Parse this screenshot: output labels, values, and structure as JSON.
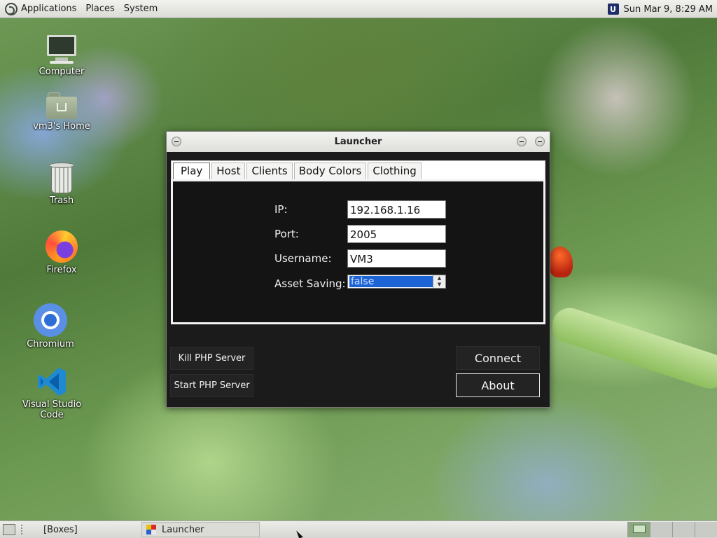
{
  "top_panel": {
    "menus": [
      "Applications",
      "Places",
      "System"
    ],
    "clock": "Sun Mar 9,  8:29 AM",
    "indicator_glyph": "U"
  },
  "desktop": {
    "icons": [
      {
        "label": "Computer",
        "icon": "computer-icon"
      },
      {
        "label": "vm3's Home",
        "icon": "home-folder-icon"
      },
      {
        "label": "Trash",
        "icon": "trash-icon"
      },
      {
        "label": "Firefox",
        "icon": "firefox-icon"
      },
      {
        "label": "Chromium",
        "icon": "chromium-icon"
      },
      {
        "label": "Visual Studio Code",
        "icon": "vscode-icon"
      }
    ]
  },
  "window": {
    "title": "Launcher",
    "tabs": [
      "Play",
      "Host",
      "Clients",
      "Body Colors",
      "Clothing"
    ],
    "active_tab": "Play",
    "form": {
      "ip_label": "IP:",
      "ip_value": "192.168.1.16",
      "port_label": "Port:",
      "port_value": "2005",
      "username_label": "Username:",
      "username_value": "VM3",
      "asset_saving_label": "Asset Saving:",
      "asset_saving_value": "false"
    },
    "buttons": {
      "kill_php": "Kill PHP Server",
      "start_php": "Start PHP Server",
      "connect": "Connect",
      "about": "About"
    }
  },
  "bottom_panel": {
    "tasks": [
      "[Boxes]",
      "Launcher"
    ],
    "active_task": "Launcher",
    "workspaces": 4,
    "active_workspace": 1
  },
  "colors": {
    "window_bg": "#1b1b1b",
    "selection": "#1c63d6",
    "panel": "#e4e4e0"
  }
}
